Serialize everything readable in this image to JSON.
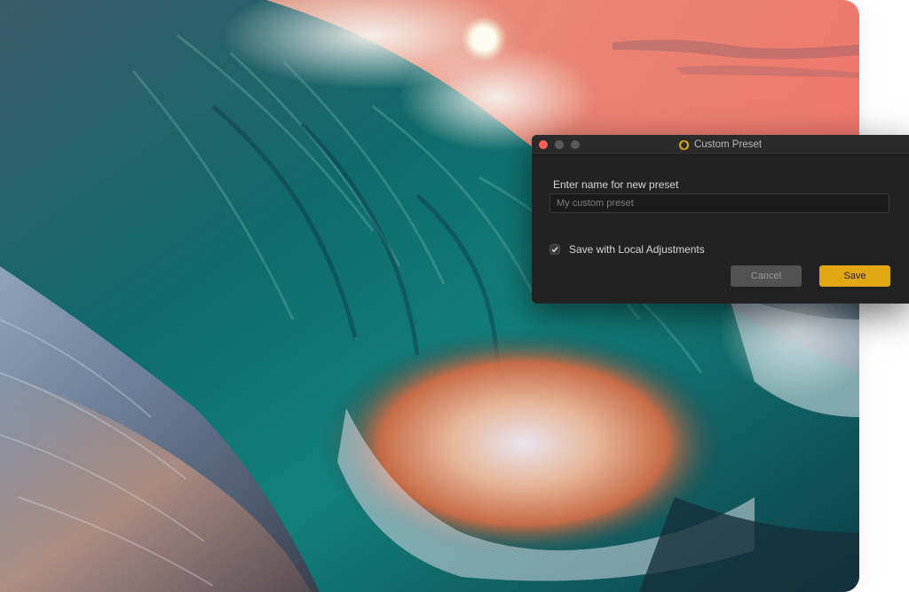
{
  "dialog": {
    "title": "Custom Preset",
    "prompt_label": "Enter name for new preset",
    "name_input": {
      "value": "",
      "placeholder": "My custom preset"
    },
    "local_adjustments": {
      "label": "Save with Local Adjustments",
      "checked": true
    },
    "buttons": {
      "cancel": "Cancel",
      "save": "Save"
    }
  },
  "colors": {
    "accent": "#e2a814",
    "close_button": "#ff5f57",
    "dialog_background": "#222222"
  },
  "icons": {
    "app_icon": "aperture-logo-icon",
    "check": "checkmark-icon"
  }
}
